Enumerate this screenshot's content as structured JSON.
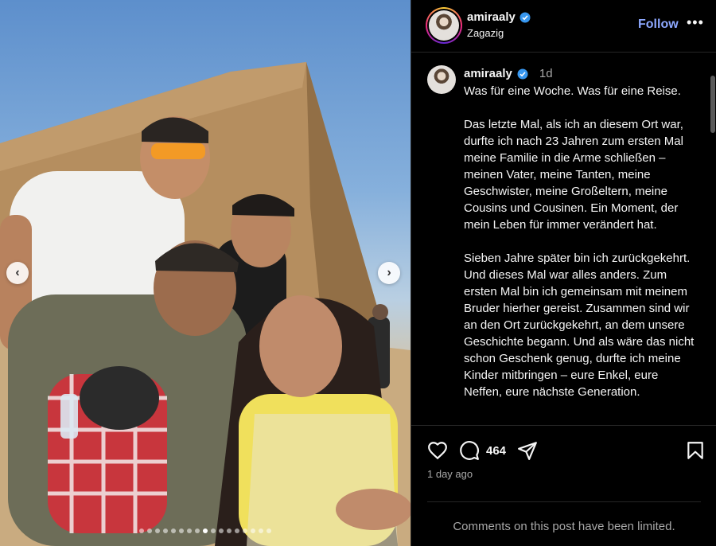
{
  "post": {
    "username": "amiraaly",
    "location": "Zagazig",
    "follow_label": "Follow",
    "more_label": "•••",
    "verified_icon": "verified-badge-icon",
    "accent_color": "#8da8ff",
    "verified_color": "#3797f0"
  },
  "caption": {
    "username": "amiraaly",
    "time": "1d",
    "paragraphs": [
      "Was für eine Woche. Was für eine Reise.",
      "Das letzte Mal, als ich an diesem Ort war, durfte ich nach 23 Jahren zum ersten Mal meine Familie in die Arme schließen – meinen Vater, meine Tanten, meine Geschwister, meine Großeltern, meine Cousins und Cousinen. Ein Moment, der mein Leben für immer verändert hat.",
      "Sieben Jahre später bin ich zurückgekehrt. Und dieses Mal war alles anders. Zum ersten Mal bin ich gemeinsam mit meinem Bruder hierher gereist. Zusammen sind wir an den Ort zurückgekehrt, an dem unsere Geschichte begann. Und als wäre das nicht schon Geschenk genug, durfte ich meine Kinder mitbringen – eure Enkel, eure Neffen, eure nächste Generation."
    ]
  },
  "actions": {
    "like_icon": "heart-icon",
    "comment_icon": "comment-icon",
    "comment_count": "464",
    "share_icon": "share-icon",
    "save_icon": "bookmark-icon",
    "posted_ago": "1 day ago",
    "comments_limited": "Comments on this post have been limited."
  },
  "carousel": {
    "prev_label": "‹",
    "next_label": "›",
    "slide_count": 17,
    "active_index": 8
  }
}
